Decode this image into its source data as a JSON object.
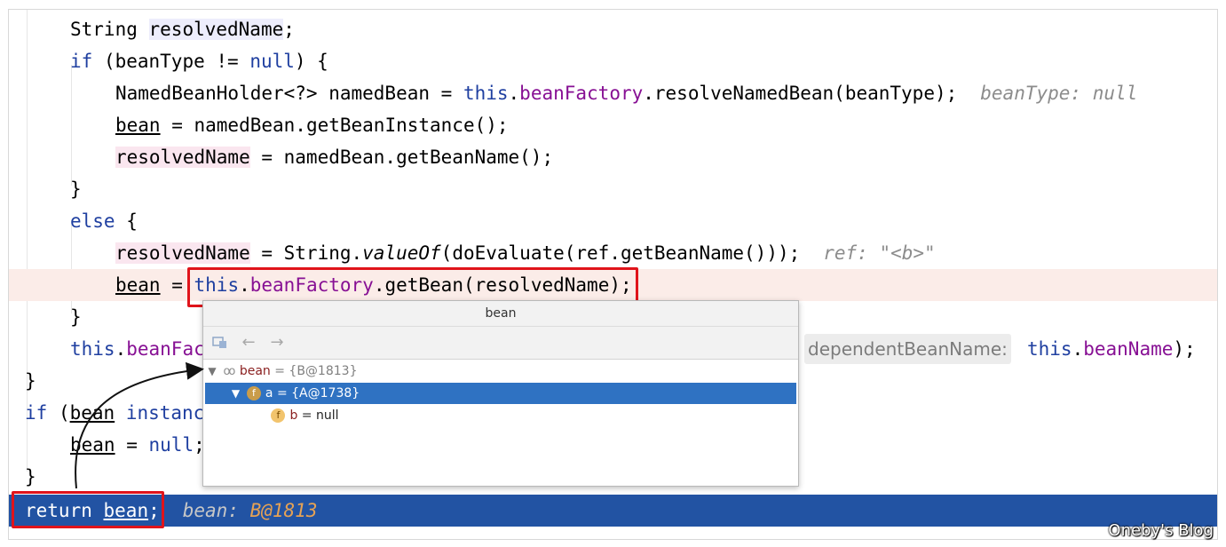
{
  "code": {
    "l1": {
      "t1": "String ",
      "var": "resolvedName",
      "t2": ";"
    },
    "l2": {
      "kw1": "if",
      "t1": " (beanType != ",
      "kw2": "null",
      "t2": ") {"
    },
    "l3": {
      "t1": "NamedBeanHolder<?> namedBean = ",
      "kw": "this",
      "dot": ".",
      "fld": "beanFactory",
      "t2": ".resolveNamedBean(beanType);",
      "hint": "beanType: null"
    },
    "l4": {
      "var": "bean",
      "t1": " = namedBean.getBeanInstance();"
    },
    "l5": {
      "var": "resolvedName",
      "t1": " = namedBean.getBeanName();"
    },
    "l6": {
      "t1": "}"
    },
    "l7": {
      "kw": "else",
      "t1": " {"
    },
    "l8": {
      "var": "resolvedName",
      "t1": " = String.",
      "m": "valueOf",
      "t2": "(doEvaluate(ref.getBeanName()));",
      "hint": "ref: \"<b>\""
    },
    "l9": {
      "var": "bean",
      "t1": " = ",
      "kw": "this",
      "dot": ".",
      "fld": "beanFactory",
      "t2": ".getBean(resolvedName);"
    },
    "l10": {
      "t1": "}"
    },
    "l11": {
      "kw": "this",
      "dot": ".",
      "fld": "beanFac",
      "hintbox": "dependentBeanName:",
      "kw2": "this",
      "dot2": ".",
      "fld2": "beanName",
      "t2": ");"
    },
    "l12": {
      "t1": "}"
    },
    "l13": {
      "kw1": "if",
      "t1": " (",
      "var": "bean",
      "sp": " ",
      "kw2": "instanc"
    },
    "l14": {
      "var": "bean",
      "t1": " = ",
      "kw": "null",
      "t2": ";"
    },
    "l15": {
      "t1": "}"
    },
    "l16": {
      "kw": "return",
      "sp": " ",
      "var": "bean",
      "t1": ";",
      "hint": "bean: ",
      "val": "B@1813"
    }
  },
  "popup": {
    "title": "bean",
    "toolbar": {
      "icon": "variables-icon",
      "back": "←",
      "forward": "→"
    },
    "tree": [
      {
        "name": "bean",
        "eq": " = ",
        "value": "{B@1813}",
        "icon": "watch-glasses-icon"
      },
      {
        "name": "a",
        "eq": " = ",
        "value": "{A@1738}",
        "badge": "f"
      },
      {
        "name": "b",
        "eq": " = ",
        "value": "null",
        "badge": "f"
      }
    ]
  },
  "watermark": "Oneby's Blog",
  "colors": {
    "keyword": "#1f3fa0",
    "field": "#871094",
    "exec_line": "#2253a3",
    "highlight_box": "#e0141b",
    "selection": "#2f72c2"
  }
}
